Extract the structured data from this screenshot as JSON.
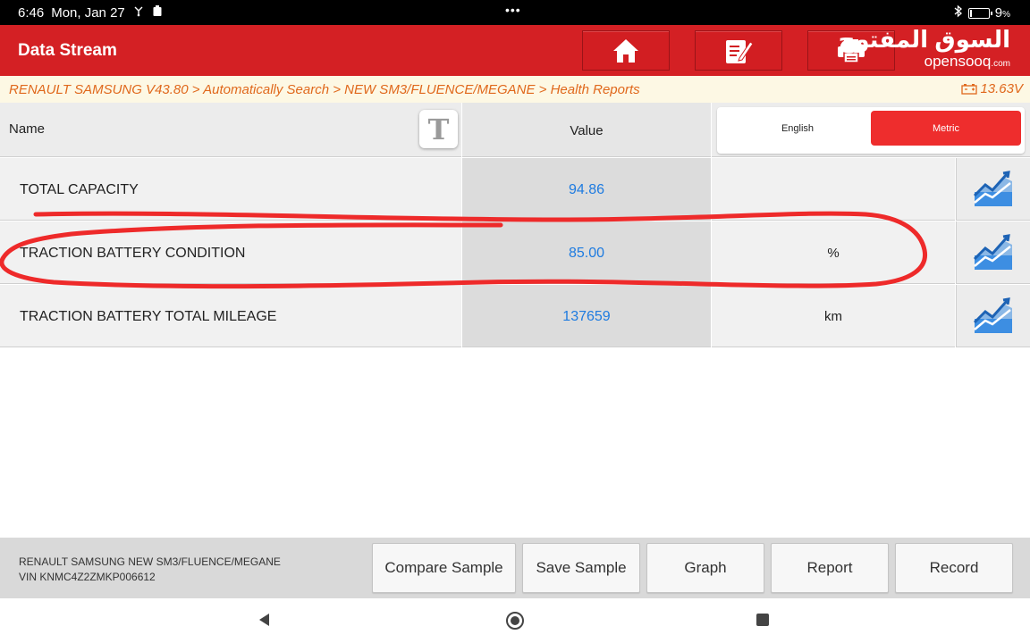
{
  "status": {
    "time": "6:46",
    "date": "Mon, Jan 27",
    "center": "•••",
    "battery_percent": "9",
    "battery_suffix": "%"
  },
  "header": {
    "title": "Data Stream",
    "buttons": [
      {
        "name": "home",
        "icon": "home-icon"
      },
      {
        "name": "edit",
        "icon": "edit-icon"
      },
      {
        "name": "print",
        "icon": "printer-icon"
      }
    ],
    "watermark_arabic": "السوق المفتوح",
    "watermark_latin": "opensooq",
    "watermark_suffix": ".com"
  },
  "breadcrumb": {
    "path": "RENAULT SAMSUNG V43.80 > Automatically Search > NEW SM3/FLUENCE/MEGANE > Health Reports",
    "voltage": "13.63V"
  },
  "table": {
    "col_name": "Name",
    "font_toggle": "T",
    "col_value": "Value",
    "units": {
      "english": "English",
      "metric": "Metric",
      "selected": "Metric"
    },
    "rows": [
      {
        "name": "TOTAL CAPACITY",
        "value": "94.86",
        "unit": ""
      },
      {
        "name": "TRACTION BATTERY CONDITION",
        "value": "85.00",
        "unit": "%"
      },
      {
        "name": "TRACTION BATTERY TOTAL MILEAGE",
        "value": "137659",
        "unit": "km"
      }
    ]
  },
  "footer": {
    "vehicle": "RENAULT SAMSUNG NEW SM3/FLUENCE/MEGANE",
    "vin": "VIN KNMC4Z2ZMKP006612",
    "buttons": [
      "Compare Sample",
      "Save Sample",
      "Graph",
      "Report",
      "Record"
    ]
  },
  "colors": {
    "accent": "#d42024",
    "value_text": "#1e7be0",
    "breadcrumb_text": "#e0681c",
    "annotation": "#ee2a2a"
  }
}
